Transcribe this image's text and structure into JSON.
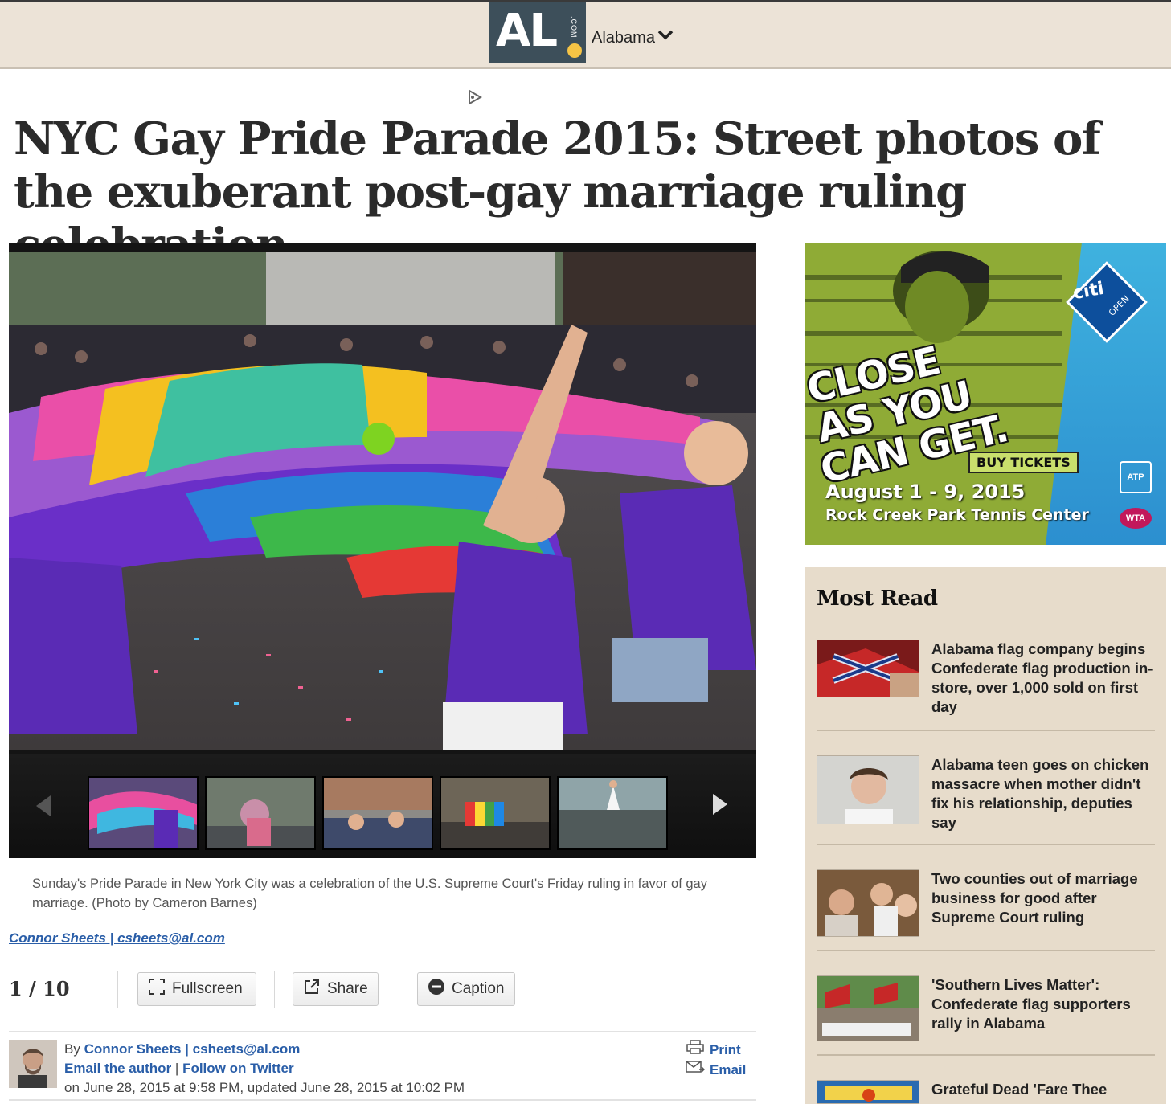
{
  "header": {
    "logo_text": "AL",
    "logo_suffix": ".COM",
    "edition": "Alabama"
  },
  "article": {
    "headline": "NYC Gay Pride Parade 2015: Street photos of the exuberant post-gay marriage ruling celebration",
    "caption": "Sunday's Pride Parade in New York City was a celebration of the U.S. Supreme Court's Friday ruling in favor of gay marriage. (Photo by Cameron Barnes)",
    "photo_credit_link": "Connor Sheets | csheets@al.com",
    "counter": "1 / 10",
    "buttons": {
      "fullscreen": "Fullscreen",
      "share": "Share",
      "caption": "Caption"
    },
    "byline": {
      "by": "By ",
      "author": "Connor Sheets | csheets@al.com",
      "email_author": "Email the author",
      "sep": " | ",
      "follow": "Follow on Twitter",
      "date": "on June 28, 2015 at 9:58 PM, updated June 28, 2015 at 10:02 PM"
    },
    "print": "Print",
    "email": "Email"
  },
  "ad": {
    "line1": "CLOSE",
    "line2": "AS YOU",
    "line3": "CAN GET.",
    "buy": "BUY TICKETS",
    "dates": "August 1 - 9, 2015",
    "venue": "Rock Creek Park Tennis Center",
    "brand": "citi",
    "brand_sub": "OPEN",
    "atp": "ATP",
    "wta": "WTA"
  },
  "most_read": {
    "title": "Most Read",
    "items": [
      {
        "title": "Alabama flag company begins Confederate flag production in-store, over 1,000 sold on first day"
      },
      {
        "title": "Alabama teen goes on chicken massacre when mother didn't fix his relationship, deputies say"
      },
      {
        "title": "Two counties out of marriage business for good after Supreme Court ruling"
      },
      {
        "title": "'Southern Lives Matter': Confederate flag supporters rally in Alabama"
      },
      {
        "title": "Grateful Dead 'Fare Thee"
      }
    ]
  },
  "colors": {
    "link": "#2a5ea8",
    "header_bg": "#ece3d7",
    "sidebar_bg": "#e7dccb",
    "logo_bg": "#3d4f5a",
    "logo_dot": "#f6c445"
  }
}
